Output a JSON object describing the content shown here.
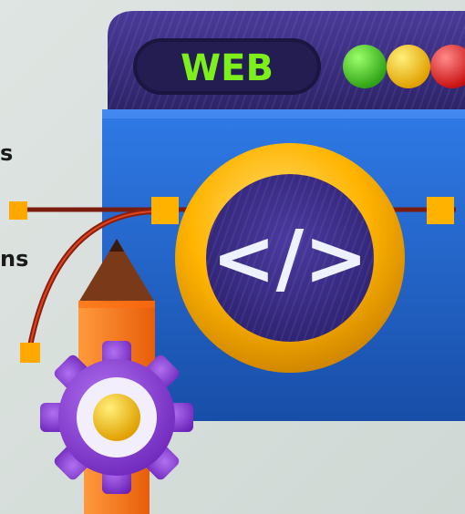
{
  "browser_window": {
    "badge_text": "WEB",
    "traffic_lights": [
      "#46c92a",
      "#ffc400",
      "#ff2a2a"
    ]
  },
  "code_icon": {
    "symbol": "</>"
  },
  "colors": {
    "window_top": "#3a2d7c",
    "window_body": "#1f63c9",
    "accent_orange": "#ffb000",
    "gear_purple": "#8b3fd6",
    "pencil_orange": "#ff7a1a"
  },
  "text_fragments": {
    "fragment_1": "s",
    "fragment_2": "ns"
  }
}
